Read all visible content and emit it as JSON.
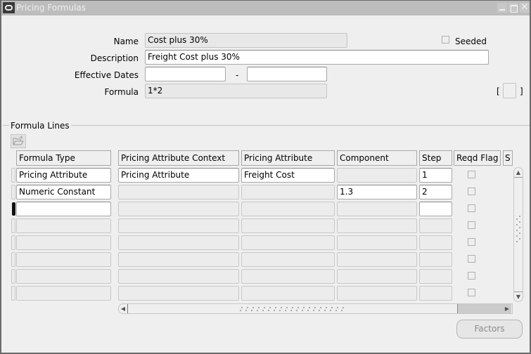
{
  "window": {
    "title": "Pricing Formulas",
    "controls": {
      "minimize": "minimize",
      "maximize": "maximize",
      "close": "✕"
    }
  },
  "header": {
    "name_label": "Name",
    "name_value": "Cost plus 30%",
    "seeded_label": "Seeded",
    "seeded_checked": false,
    "description_label": "Description",
    "description_value": "Freight Cost plus 30%",
    "effective_dates_label": "Effective Dates",
    "date_from": "",
    "date_to": "",
    "date_separator": "-",
    "formula_label": "Formula",
    "formula_value": "1*2",
    "bracket_open": "[",
    "bracket_close": "]"
  },
  "formula_lines": {
    "title": "Formula Lines",
    "columns": [
      "Formula Type",
      "Pricing Attribute Context",
      "Pricing Attribute",
      "Component",
      "Step",
      "Reqd Flag",
      "S"
    ],
    "rows": [
      {
        "formula_type": "Pricing Attribute",
        "context": "Pricing Attribute",
        "attribute": "Freight Cost",
        "component": "",
        "step": "1",
        "reqd_flag": false
      },
      {
        "formula_type": "Numeric Constant",
        "context": "",
        "attribute": "",
        "component": "1.3",
        "step": "2",
        "reqd_flag": false
      },
      {
        "formula_type": "",
        "context": "",
        "attribute": "",
        "component": "",
        "step": "",
        "reqd_flag": false
      },
      {
        "formula_type": "",
        "context": "",
        "attribute": "",
        "component": "",
        "step": "",
        "reqd_flag": false
      },
      {
        "formula_type": "",
        "context": "",
        "attribute": "",
        "component": "",
        "step": "",
        "reqd_flag": false
      },
      {
        "formula_type": "",
        "context": "",
        "attribute": "",
        "component": "",
        "step": "",
        "reqd_flag": false
      },
      {
        "formula_type": "",
        "context": "",
        "attribute": "",
        "component": "",
        "step": "",
        "reqd_flag": false
      },
      {
        "formula_type": "",
        "context": "",
        "attribute": "",
        "component": "",
        "step": "",
        "reqd_flag": false
      }
    ],
    "current_row": 3
  },
  "buttons": {
    "factors": "Factors"
  },
  "icons": {
    "folder": "folder-open-icon",
    "scroll_up": "▲",
    "scroll_down": "▼",
    "scroll_left": "◀",
    "scroll_right": "▶"
  }
}
